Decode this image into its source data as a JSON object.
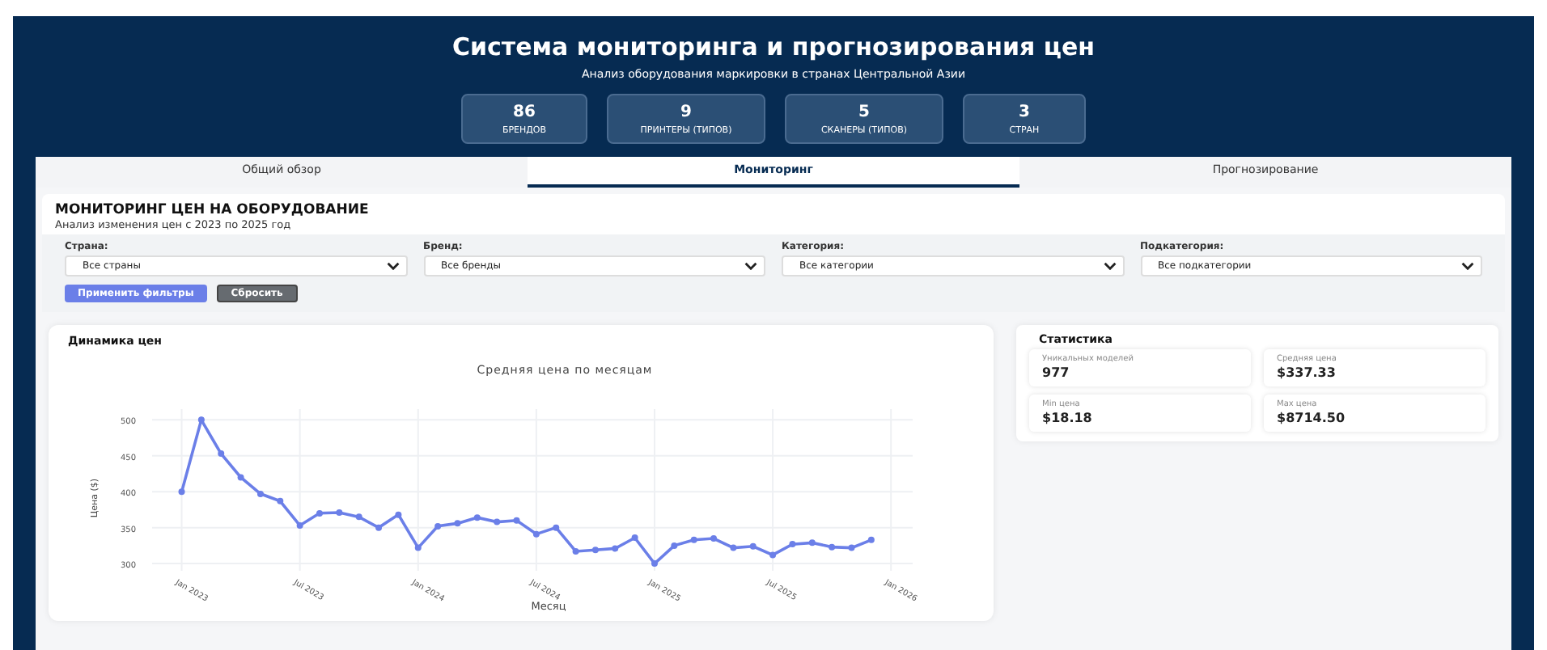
{
  "header": {
    "title": "Система мониторинга и прогнозирования цен",
    "subtitle": "Анализ оборудования маркировки в странах Центральной Азии",
    "stats": [
      {
        "value": "86",
        "label": "БРЕНДОВ"
      },
      {
        "value": "9",
        "label": "ПРИНТЕРЫ (ТИПОВ)"
      },
      {
        "value": "5",
        "label": "СКАНЕРЫ (ТИПОВ)"
      },
      {
        "value": "3",
        "label": "СТРАН"
      }
    ]
  },
  "tabs": [
    {
      "label": "Общий обзор",
      "selected": false
    },
    {
      "label": "Мониторинг",
      "selected": true
    },
    {
      "label": "Прогнозирование",
      "selected": false
    }
  ],
  "monitoring": {
    "title": "МОНИТОРИНГ ЦЕН НА ОБОРУДОВАНИЕ",
    "subtitle": "Анализ изменения цен с 2023 по 2025 год",
    "filters": [
      {
        "label": "Страна:",
        "value": "Все страны"
      },
      {
        "label": "Бренд:",
        "value": "Все бренды"
      },
      {
        "label": "Категория:",
        "value": "Все категории"
      },
      {
        "label": "Подкатегория:",
        "value": "Все подкатегории"
      }
    ],
    "buttons": [
      {
        "label": "Применить фильтры",
        "kind": "primary"
      },
      {
        "label": "Сбросить",
        "kind": "secondary"
      }
    ]
  },
  "chart_panel": {
    "title": "Динамика цен",
    "chart_data": {
      "type": "line",
      "title": "Средняя цена по месяцам",
      "xlabel": "Месяц",
      "ylabel": "Цена ($)",
      "categories": [
        "Jan 2023",
        null,
        null,
        null,
        null,
        null,
        "Jul 2023",
        null,
        null,
        null,
        null,
        null,
        "Jan 2024",
        null,
        null,
        null,
        null,
        null,
        "Jul 2024",
        null,
        null,
        null,
        null,
        null,
        "Jan 2025",
        null,
        null,
        null,
        null,
        null,
        "Jul 2025",
        null,
        null,
        null,
        null,
        null,
        "Jan 2026"
      ],
      "series": [
        {
          "color": "#6b7fe8",
          "marker": true,
          "values": [
            400,
            500,
            453,
            420,
            397,
            387,
            353,
            370,
            371,
            365,
            350,
            368,
            322,
            352,
            356,
            364,
            358,
            360,
            341,
            350,
            317,
            319,
            321,
            336,
            300,
            325,
            333,
            335,
            322,
            324,
            312,
            327,
            329,
            323,
            322,
            333,
            null
          ]
        }
      ],
      "grid": true,
      "ylim": [
        290,
        515
      ],
      "yticks": [
        300,
        350,
        400,
        450,
        500
      ]
    }
  },
  "statistics": {
    "title": "Статистика",
    "items": [
      {
        "label": "Уникальных моделей",
        "value": "977"
      },
      {
        "label": "Средняя цена",
        "value": "$337.33"
      },
      {
        "label": "Min цена",
        "value": "$18.18"
      },
      {
        "label": "Max цена",
        "value": "$8714.50"
      }
    ]
  }
}
